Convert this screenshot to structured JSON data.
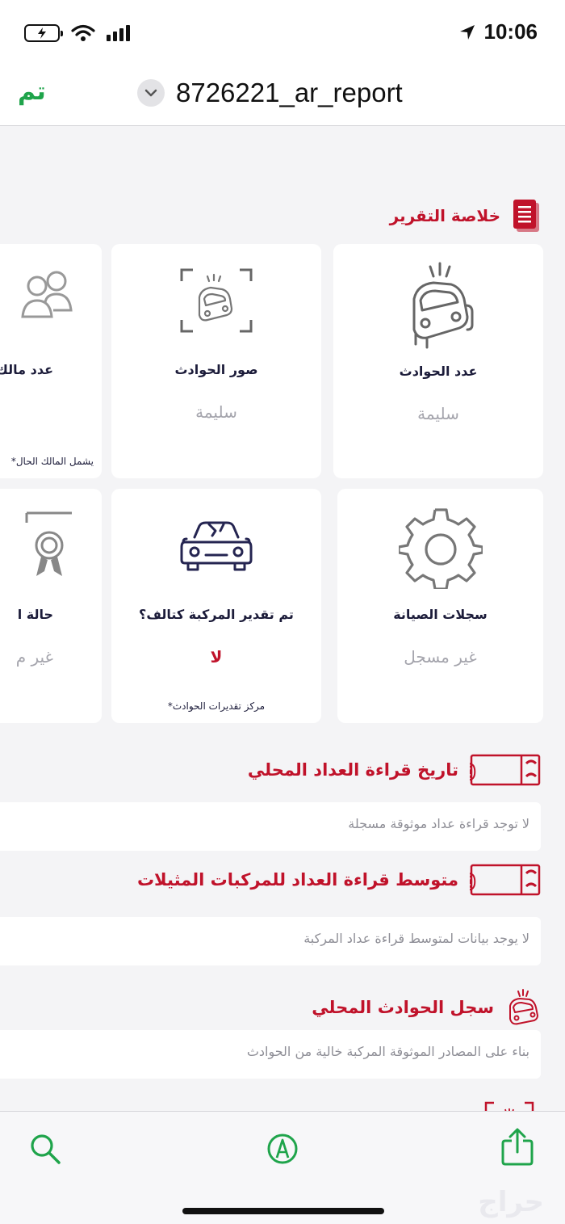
{
  "status_bar": {
    "time": "10:06",
    "icons": [
      "battery-charging-icon",
      "wifi-icon",
      "signal-icon",
      "location-arrow-icon"
    ]
  },
  "nav_bar": {
    "done_label": "تم",
    "document_title": "8726221_ar_report",
    "menu_icon": "chevron-down-icon"
  },
  "summary": {
    "title": "خلاصة التقرير",
    "icon": "report-document-icon",
    "cards": [
      {
        "label": "عدد الحوادث",
        "value": "سليمة",
        "icon": "crashed-car-icon"
      },
      {
        "label": "صور الحوادث",
        "value": "سليمة",
        "icon": "accident-photo-icon"
      },
      {
        "label": "عدد مالك",
        "value": "",
        "note": "*يشمل المالك الحال",
        "icon": "owners-icon"
      },
      {
        "label": "سجلات الصيانة",
        "value": "غير مسجل",
        "icon": "gear-icon"
      },
      {
        "label": "تم تقدير المركبة كتالف؟",
        "value": "لا",
        "note": "*مركز تقديرات الحوادث",
        "icon": "damaged-car-icon"
      },
      {
        "label": "حالة ا",
        "value": "غير م",
        "icon": "certificate-icon"
      }
    ]
  },
  "odometer_history": {
    "title": "تاريخ قراءة العداد المحلي",
    "message": "لا توجد قراءة عداد موثوقة مسجلة",
    "icon": "odometer-icon",
    "digits": "000"
  },
  "odometer_average": {
    "title": "متوسط قراءة العداد للمركبات المثيلات",
    "message": "لا يوجد بيانات لمتوسط قراءة عداد المركبة",
    "icon": "odometer-icon",
    "digits": "000"
  },
  "accident_history": {
    "title": "سجل الحوادث المحلي",
    "message": "بناء على المصادر الموثوقة المركبة خالية من الحوادث",
    "icon": "crashed-car-icon"
  },
  "toolbar": {
    "items": [
      "search-icon",
      "markup-pen-icon",
      "share-icon"
    ]
  },
  "watermark": "حراج",
  "colors": {
    "accent_red": "#c0122a",
    "done_green": "#1fa44b",
    "card_bg": "#ffffff",
    "page_bg": "#f4f4f6"
  }
}
